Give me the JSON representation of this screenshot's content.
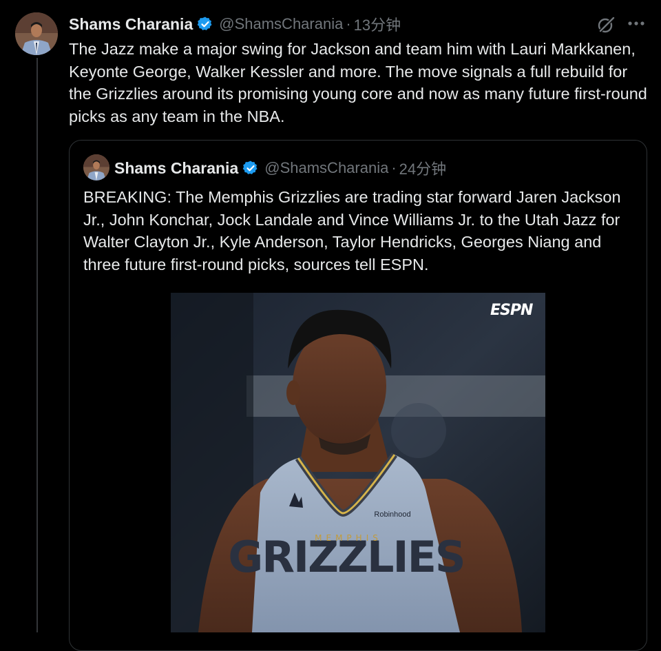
{
  "tweet": {
    "author_name": "Shams Charania",
    "handle": "@ShamsCharania",
    "separator": "·",
    "time": "13分钟",
    "text": "The Jazz make a major swing for Jackson and team him with Lauri Markkanen, Keyonte George, Walker Kessler and more. The move signals a full rebuild for the Grizzlies around its promising young core and now as many future first-round picks as any team in the NBA."
  },
  "quoted": {
    "author_name": "Shams Charania",
    "handle": "@ShamsCharania",
    "separator": "·",
    "time": "24分钟",
    "text": "BREAKING: The Memphis Grizzlies are trading star forward Jaren Jackson Jr., John Konchar, Jock Landale and Vince Williams Jr. to the Utah Jazz for Walter Clayton Jr., Kyle Anderson, Taylor Hendricks, Georges Niang and three future first-round picks, sources tell ESPN."
  },
  "media": {
    "watermark": "ESPN",
    "jersey_text": "GRIZZLIES",
    "jersey_city": "MEMPHIS",
    "sponsor": "Robinhood"
  },
  "colors": {
    "background": "#000000",
    "text": "#e7e9ea",
    "secondary": "#71767b",
    "verified": "#1d9bf0",
    "border": "#2f3336"
  }
}
